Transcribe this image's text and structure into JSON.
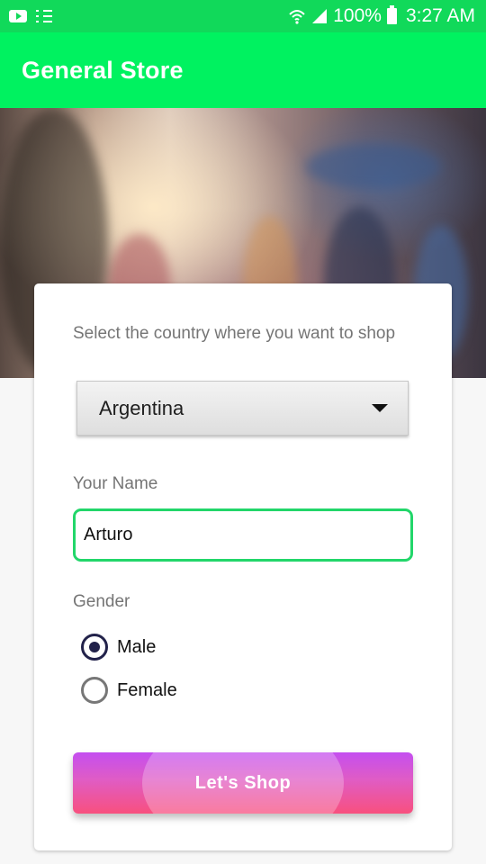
{
  "status_bar": {
    "battery": "100%",
    "time": "3:27 AM",
    "icons": [
      "youtube-icon",
      "list-icon",
      "wifi-icon",
      "signal-icon",
      "battery-icon"
    ]
  },
  "app_bar": {
    "title": "General Store"
  },
  "form": {
    "country_label": "Select the country where you want to shop",
    "country_value": "Argentina",
    "name_label": "Your Name",
    "name_value": "Arturo",
    "gender_label": "Gender",
    "gender_options": [
      {
        "label": "Male",
        "selected": true
      },
      {
        "label": "Female",
        "selected": false
      }
    ],
    "submit_label": "Let's  Shop"
  },
  "colors": {
    "status_bar": "#11d95a",
    "app_bar": "#00f260",
    "field_focus": "#22d66a",
    "button_top": "#c44ef0",
    "button_bottom": "#f8507e"
  }
}
